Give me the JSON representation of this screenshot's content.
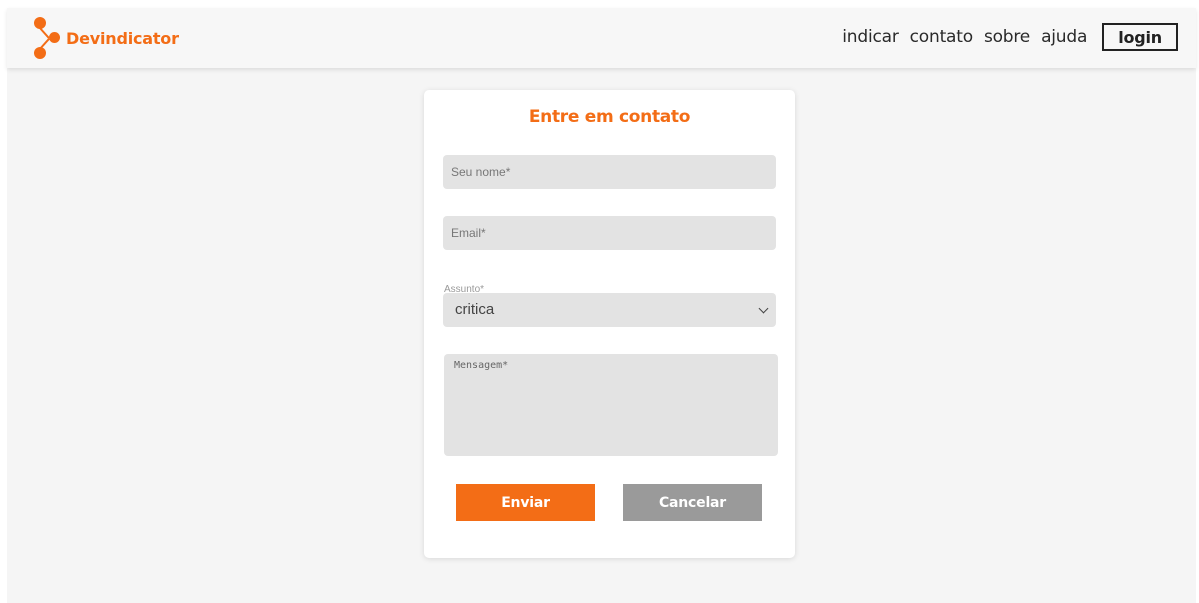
{
  "header": {
    "brand": "Devindicator",
    "nav": [
      "indicar",
      "contato",
      "sobre",
      "ajuda"
    ],
    "login_label": "login"
  },
  "form": {
    "title": "Entre em contato",
    "name_placeholder": "Seu nome*",
    "email_placeholder": "Email*",
    "subject_label": "Assunto*",
    "subject_value": "critica",
    "message_placeholder": "Mensagem*",
    "submit_label": "Enviar",
    "cancel_label": "Cancelar"
  },
  "colors": {
    "accent": "#f36d16",
    "secondary_button": "#9a9a9a",
    "field_background": "#e3e3e3"
  },
  "icons": {
    "logo": "connected-dots-logo-icon",
    "select": "chevron-down-icon"
  }
}
